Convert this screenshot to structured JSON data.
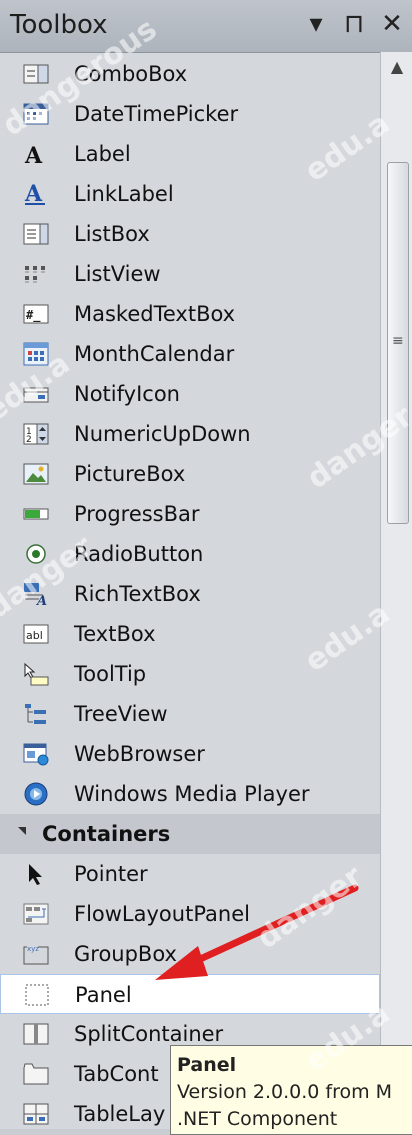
{
  "window": {
    "title": "Toolbox",
    "buttons": [
      {
        "name": "dropdown-arrow",
        "glyph": "▾"
      },
      {
        "name": "pin",
        "glyph": "⊓"
      },
      {
        "name": "close",
        "glyph": "✕"
      }
    ]
  },
  "items": [
    {
      "label": "ComboBox",
      "icon": "combobox-icon"
    },
    {
      "label": "DateTimePicker",
      "icon": "calendar-icon"
    },
    {
      "label": "Label",
      "icon": "label-icon"
    },
    {
      "label": "LinkLabel",
      "icon": "linklabel-icon"
    },
    {
      "label": "ListBox",
      "icon": "listbox-icon"
    },
    {
      "label": "ListView",
      "icon": "listview-icon"
    },
    {
      "label": "MaskedTextBox",
      "icon": "maskedtextbox-icon"
    },
    {
      "label": "MonthCalendar",
      "icon": "monthcalendar-icon"
    },
    {
      "label": "NotifyIcon",
      "icon": "notifyicon-icon"
    },
    {
      "label": "NumericUpDown",
      "icon": "numericupdown-icon"
    },
    {
      "label": "PictureBox",
      "icon": "picturebox-icon"
    },
    {
      "label": "ProgressBar",
      "icon": "progressbar-icon"
    },
    {
      "label": "RadioButton",
      "icon": "radiobutton-icon"
    },
    {
      "label": "RichTextBox",
      "icon": "richtextbox-icon"
    },
    {
      "label": "TextBox",
      "icon": "textbox-icon"
    },
    {
      "label": "ToolTip",
      "icon": "tooltip-icon"
    },
    {
      "label": "TreeView",
      "icon": "treeview-icon"
    },
    {
      "label": "WebBrowser",
      "icon": "webbrowser-icon"
    },
    {
      "label": "Windows Media Player",
      "icon": "mediaplayer-icon"
    }
  ],
  "section": {
    "label": "Containers"
  },
  "containers": [
    {
      "label": "Pointer",
      "icon": "pointer-icon"
    },
    {
      "label": "FlowLayoutPanel",
      "icon": "flowlayoutpanel-icon"
    },
    {
      "label": "GroupBox",
      "icon": "groupbox-icon"
    },
    {
      "label": "Panel",
      "icon": "panel-icon",
      "selected": true
    },
    {
      "label": "SplitContainer",
      "icon": "splitcontainer-icon"
    },
    {
      "label": "TabCont",
      "icon": "tabcontrol-icon"
    },
    {
      "label": "TableLay",
      "icon": "tablelayout-icon"
    }
  ],
  "tooltip": {
    "title": "Panel",
    "line1": "Version 2.0.0.0 from M",
    "line2": ".NET Component"
  },
  "watermarks": [
    "dangerous",
    "edu.a",
    "edu.a",
    "danger",
    "danger",
    "edu.a",
    "danger",
    "edu.a"
  ],
  "colors": {
    "selection": "#ffffff",
    "arrow": "#e02020",
    "tooltip_bg": "#fffde3"
  }
}
